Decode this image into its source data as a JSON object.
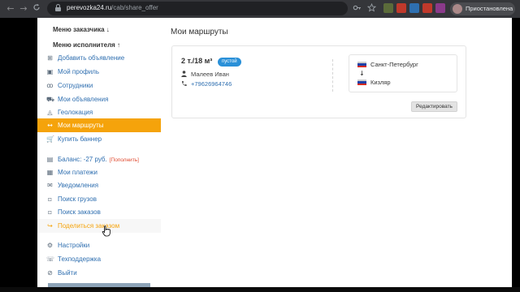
{
  "browser": {
    "url_host": "perevozka24.ru",
    "url_path": "/cab/share_offer",
    "profile_label": "Приостановлена",
    "nav": {
      "back": "←",
      "forward": "→",
      "reload": "C"
    },
    "icons": [
      "key-icon",
      "star-icon"
    ]
  },
  "sidebar": {
    "customer_menu": "Меню заказчика ↓",
    "executor_menu": "Меню исполнителя ↑",
    "items": [
      {
        "label": "Добавить объявление",
        "icon": "⊞"
      },
      {
        "label": "Мой профиль",
        "icon": "▣"
      },
      {
        "label": "Сотрудники",
        "icon": "ꝏ"
      },
      {
        "label": "Мои объявления",
        "icon": "⛟"
      },
      {
        "label": "Геолокация",
        "icon": "◬"
      },
      {
        "label": "Мои маршруты",
        "icon": "↔"
      },
      {
        "label": "Купить баннер",
        "icon": "🛒"
      }
    ],
    "balance": {
      "label": "Баланс: -27 руб.",
      "topup": "[Пополнить]",
      "icon": "▤"
    },
    "items2": [
      {
        "label": "Мои платежи",
        "icon": "▦"
      },
      {
        "label": "Уведомления",
        "icon": "✉"
      },
      {
        "label": "Поиск грузов",
        "icon": "▫"
      },
      {
        "label": "Поиск заказов",
        "icon": "▫"
      },
      {
        "label": "Поделиться заказом",
        "icon": "↪"
      }
    ],
    "items3": [
      {
        "label": "Настройки",
        "icon": "⚙"
      },
      {
        "label": "Техподдержка",
        "icon": "☏"
      },
      {
        "label": "Выйти",
        "icon": "⊘"
      }
    ]
  },
  "main": {
    "title": "Мои маршруты",
    "card": {
      "capacity": "2 т./18 м³",
      "badge": "пустой",
      "person": "Малеев Иван",
      "phone": "+79626964746",
      "from": "Санкт-Петербург",
      "to": "Кизляр",
      "arrow": "↓",
      "edit": "Редактировать"
    }
  },
  "colors": {
    "accent": "#f5a30b",
    "link": "#2f6fb0",
    "badge": "#2a90d8",
    "topup": "#e04a2f"
  }
}
